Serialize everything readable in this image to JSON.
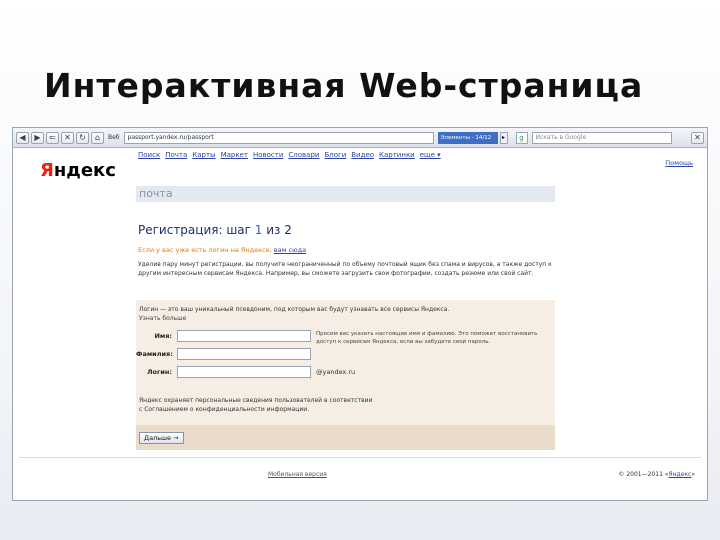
{
  "slide": {
    "title": "Интерактивная Web-страница"
  },
  "toolbar": {
    "back_icon": "back-arrow-icon",
    "forward_icon": "forward-arrow-icon",
    "history_icon": "history-icon",
    "reload_icon": "reload-icon",
    "stop_icon": "stop-icon",
    "home_icon": "home-icon",
    "label": "Веб",
    "address": "passport.yandex.ru/passport",
    "find_value": "Элементы - 14/12",
    "search_placeholder": "Искать в Google",
    "close_glyph": "✕"
  },
  "page": {
    "logo_first": "Я",
    "logo_rest": "ндекс",
    "nav": [
      "Поиск",
      "Почта",
      "Карты",
      "Маркет",
      "Новости",
      "Словари",
      "Блоги",
      "Видео",
      "Картинки",
      "еще ▾"
    ],
    "help": "Помощь",
    "service": "почта",
    "reg_title_prefix": "Регистрация: шаг ",
    "reg_step": "1",
    "reg_title_suffix": " из 2",
    "existing_text": "Если у вас уже есть логин на Яндексе, ",
    "existing_link": "вам сюда",
    "description": "Уделив пару минут регистрации, вы получите неограниченный по объему почтовый ящик без спама и вирусов, а также доступ к другим интересным сервисам Яндекса. Например, вы сможете загрузить свои фотографии, создать резюме или свой сайт.",
    "form_intro": "Логин — это ваш уникальный псевдоним, под которым вас будут узнавать все сервисы Яндекса.",
    "form_more": "Узнать больше",
    "fields": {
      "first_name_label": "Имя:",
      "last_name_label": "Фамилия:",
      "login_label": "Логин:",
      "first_name_value": "",
      "last_name_value": "",
      "login_value": ""
    },
    "hint": "Просим вас указать настоящие имя и фамилию. Это поможет восстановить доступ к сервисам Яндекса, если вы забудете свой пароль.",
    "domain_suffix": "@yandex.ru",
    "privacy_line1": "Яндекс охраняет персональные сведения пользователей в соответствии",
    "privacy_line2": "с Соглашением о конфиденциальности информации.",
    "submit": "Дальше →",
    "mobile": "Мобильная версия",
    "copyright": "© 2001—2011 «",
    "copyright_link": "Яндекс",
    "copyright_end": "»"
  }
}
